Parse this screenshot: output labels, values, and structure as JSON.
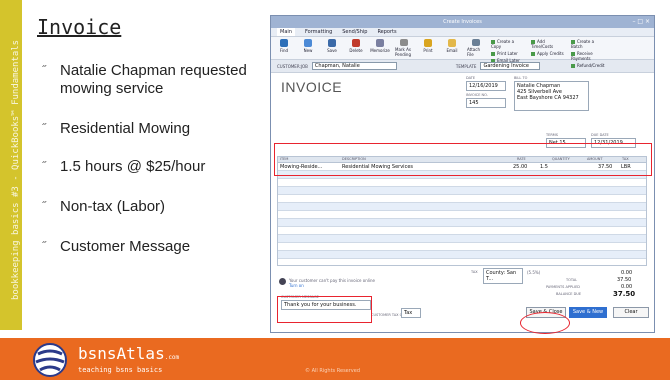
{
  "slide": {
    "title": "Invoice",
    "sidebar_text": "bookkeeping basics #3 - QuickBooks™ Fundamentals",
    "bullet_marker": "˝",
    "bullets": [
      "Natalie Chapman requested mowing service",
      "Residential Mowing",
      "1.5 hours @ $25/hour",
      "Non-tax (Labor)",
      "Customer Message"
    ]
  },
  "window": {
    "title": "Create Invoices",
    "controls": "– □ ×",
    "menu": [
      "Main",
      "Formatting",
      "Send/Ship",
      "Reports"
    ],
    "ribbon": [
      {
        "label": "Find",
        "icon": "arrows-icon",
        "color": "#2d6fb8"
      },
      {
        "label": "New",
        "icon": "new-doc-icon",
        "color": "#4c8ad6"
      },
      {
        "label": "Save",
        "icon": "save-icon",
        "color": "#3b6aa8"
      },
      {
        "label": "Delete",
        "icon": "delete-icon",
        "color": "#c03a2b"
      },
      {
        "label": "Memorize",
        "icon": "memorize-icon",
        "color": "#7a7fa0"
      },
      {
        "label": "Mark As Pending",
        "icon": "pending-icon",
        "color": "#8c8c8c"
      },
      {
        "label": "Print",
        "icon": "print-icon",
        "color": "#d9a520"
      },
      {
        "label": "Email",
        "icon": "email-icon",
        "color": "#e3b84a"
      },
      {
        "label": "Attach File",
        "icon": "paperclip-icon",
        "color": "#6a7f96"
      }
    ],
    "ribbon_small_1": [
      "Create a Copy",
      "Print Later",
      "Email Later"
    ],
    "ribbon_small_2": [
      "Add Time/Costs",
      "Apply Credits"
    ],
    "ribbon_small_3": [
      "Create a Batch",
      "Receive Payments",
      "Refund/Credit"
    ]
  },
  "customer": {
    "label": "CUSTOMER:JOB",
    "value": "Chapman, Natalie",
    "template_label": "TEMPLATE",
    "template_value": "Gardening Invoice"
  },
  "invoice": {
    "title": "INVOICE",
    "date_label": "DATE",
    "date": "12/16/2019",
    "number_label": "INVOICE NO.",
    "number": "145",
    "bill_to_label": "BILL TO",
    "bill_to": [
      "Natalie Chapman",
      "425 Silverbell Ave",
      "East Bayshore CA 94327"
    ],
    "terms_label": "TERMS",
    "terms": "Net 15",
    "due_label": "DUE DATE",
    "due_date": "12/31/2019"
  },
  "line_items": {
    "headers": [
      "ITEM",
      "DESCRIPTION",
      "RATE",
      "QUANTITY",
      "AMOUNT",
      "TAX"
    ],
    "rows": [
      {
        "item": "Mowing-Reside...",
        "description": "Residential Mowing Services",
        "rate": "25.00",
        "quantity": "1.5",
        "amount": "37.50",
        "tax": "LBR"
      }
    ]
  },
  "footer_form": {
    "online_note": "Your customer can't pay this invoice online",
    "turn_on": "Turn on",
    "message_label": "CUSTOMER MESSAGE",
    "message": "Thank you for your business.",
    "tax_label": "TAX",
    "tax_value": "County: San T...",
    "tax_rate": "(5.5%)",
    "tax_amount": "0.00",
    "total_label": "TOTAL",
    "total": "37.50",
    "payments_label": "PAYMENTS APPLIED",
    "payments": "0.00",
    "balance_label": "BALANCE DUE",
    "balance": "37.50",
    "cust_tax_label": "CUSTOMER TAX CODE",
    "cust_tax": "Tax"
  },
  "buttons": {
    "save_close": "Save & Close",
    "save_new": "Save & New",
    "clear": "Clear"
  },
  "branding": {
    "name": "bsnsAtlas",
    "suffix": ".com",
    "tagline": "teaching bsns basics",
    "copyright": "© All Rights Reserved"
  },
  "colors": {
    "sidebar": "#d4c42c",
    "footer": "#ea6a20",
    "highlight": "#e8242f",
    "accent": "#2f6fd0"
  }
}
